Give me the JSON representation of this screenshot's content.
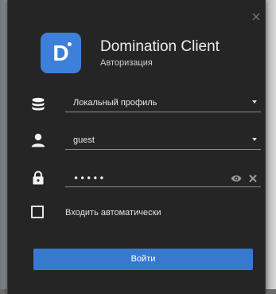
{
  "app": {
    "title": "Domination Client",
    "subtitle": "Авторизация",
    "logo_letter": "D"
  },
  "form": {
    "profile": {
      "value": "Локальный профиль",
      "icon": "database-icon"
    },
    "username": {
      "value": "guest",
      "icon": "user-icon"
    },
    "password": {
      "masked_value": "•••••",
      "icon": "lock-icon"
    },
    "auto_login": {
      "label": "Входить автоматически",
      "checked": false
    },
    "submit_label": "Войти"
  },
  "colors": {
    "window_bg": "#252525",
    "accent": "#3978cf",
    "logo_bg": "#3d7fd9",
    "text": "#e8e8e8"
  }
}
